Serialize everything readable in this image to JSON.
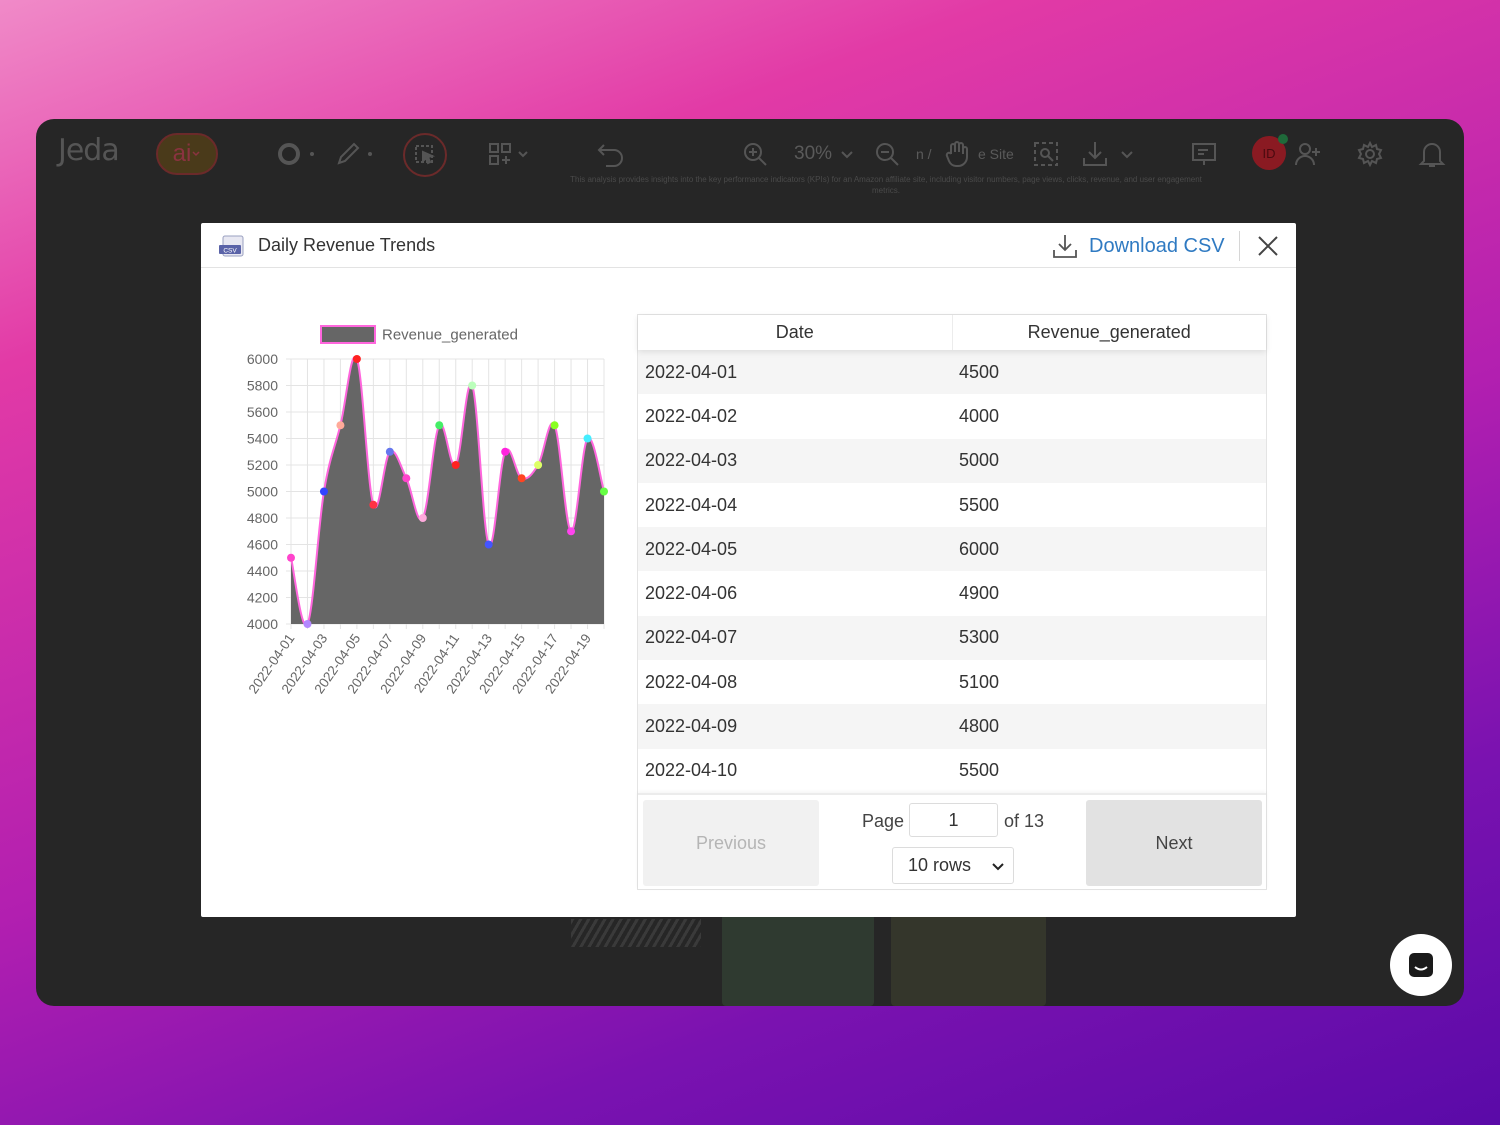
{
  "app": {
    "logo_text": "Jeda",
    "ai_label": "ai",
    "zoom": "30%",
    "faded_label_1": "n /",
    "faded_label_2": "e Site",
    "avatar_initials": "ID",
    "description": "This analysis provides insights into the key performance indicators (KPIs) for an Amazon affiliate site, including visitor numbers, page views, clicks, revenue, and user engagement metrics."
  },
  "modal": {
    "title": "Daily Revenue Trends",
    "csv_icon_label": "CSV",
    "download_label": "Download CSV"
  },
  "table": {
    "columns": [
      "Date",
      "Revenue_generated"
    ],
    "rows": [
      [
        "2022-04-01",
        "4500"
      ],
      [
        "2022-04-02",
        "4000"
      ],
      [
        "2022-04-03",
        "5000"
      ],
      [
        "2022-04-04",
        "5500"
      ],
      [
        "2022-04-05",
        "6000"
      ],
      [
        "2022-04-06",
        "4900"
      ],
      [
        "2022-04-07",
        "5300"
      ],
      [
        "2022-04-08",
        "5100"
      ],
      [
        "2022-04-09",
        "4800"
      ],
      [
        "2022-04-10",
        "5500"
      ]
    ]
  },
  "pager": {
    "previous_label": "Previous",
    "next_label": "Next",
    "page_label": "Page",
    "page_value": "1",
    "of_label": "of 13",
    "rows_label": "10 rows"
  },
  "chart_data": {
    "type": "area",
    "series": [
      {
        "name": "Revenue_generated",
        "x": [
          "2022-04-01",
          "2022-04-02",
          "2022-04-03",
          "2022-04-04",
          "2022-04-05",
          "2022-04-06",
          "2022-04-07",
          "2022-04-08",
          "2022-04-09",
          "2022-04-10",
          "2022-04-11",
          "2022-04-12",
          "2022-04-13",
          "2022-04-14",
          "2022-04-15",
          "2022-04-16",
          "2022-04-17",
          "2022-04-18",
          "2022-04-19",
          "2022-04-20"
        ],
        "values": [
          4500,
          4000,
          5000,
          5500,
          6000,
          4900,
          5300,
          5100,
          4800,
          5500,
          5200,
          5800,
          4600,
          5300,
          5100,
          5200,
          5500,
          4700,
          5400,
          5000
        ]
      }
    ],
    "xtick_labels": [
      "2022-04-01",
      "2022-04-03",
      "2022-04-05",
      "2022-04-07",
      "2022-04-09",
      "2022-04-11",
      "2022-04-13",
      "2022-04-15",
      "2022-04-17",
      "2022-04-19"
    ],
    "yticks": [
      4000,
      4200,
      4400,
      4600,
      4800,
      5000,
      5200,
      5400,
      5600,
      5800,
      6000
    ],
    "ylim": [
      4000,
      6000
    ],
    "legend_position": "top",
    "grid": true,
    "fill_color": "#666666",
    "line_color": "#ff66dd",
    "point_colors": [
      "#ff44cc",
      "#b388ff",
      "#3344ff",
      "#ffaa99",
      "#ff2222",
      "#ff3344",
      "#6677ee",
      "#ff44cc",
      "#ffaadd",
      "#44ee66",
      "#ff2222",
      "#bbffbb",
      "#4455ff",
      "#ff22dd",
      "#ff4422",
      "#ddff66",
      "#88ff22",
      "#ff44ee",
      "#44eeff",
      "#66ff44"
    ]
  }
}
